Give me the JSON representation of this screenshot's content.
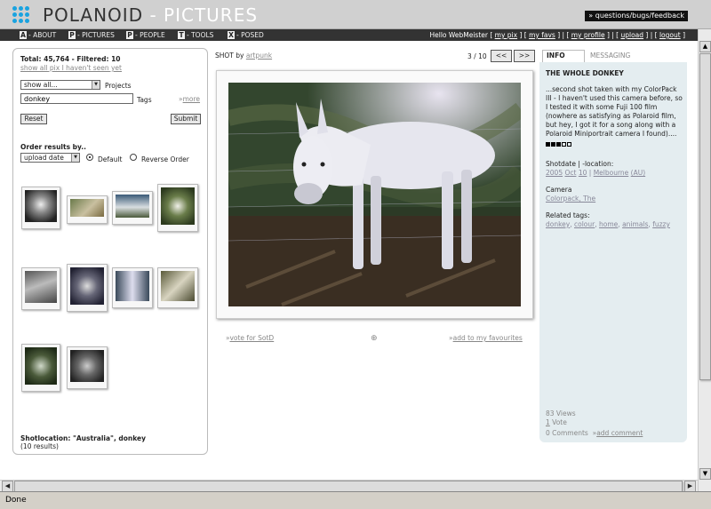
{
  "header": {
    "brand_main": "POLANOID",
    "brand_sub": " - PICTURES",
    "feedback_label": "» questions/bugs/feedback",
    "logo_icon": "dots-grid-icon",
    "logo_color": "#1aa3e0"
  },
  "nav": {
    "items": [
      {
        "key": "A",
        "label": "- ABOUT"
      },
      {
        "key": "P",
        "label": "- PICTURES"
      },
      {
        "key": "P",
        "label": "- PEOPLE"
      },
      {
        "key": "T",
        "label": "- TOOLS"
      },
      {
        "key": "X",
        "label": "- POSED"
      }
    ],
    "greeting": "Hello WebMeister",
    "user_links": [
      "my pix",
      "my favs",
      "my profile",
      "upload",
      "logout"
    ]
  },
  "filter": {
    "totals": "Total: 45,764 - Filtered: 10",
    "show_all_link": "show all pix I haven't seen yet",
    "project_select": "show all...",
    "projects_label": "Projects",
    "tags_value": "donkey",
    "tags_label": "Tags",
    "more_prefix": "»",
    "more_label": "more",
    "reset_label": "Reset",
    "submit_label": "Submit",
    "order_label": "Order results by..",
    "order_select": "upload date",
    "default_label": "Default",
    "reverse_label": "Reverse Order",
    "shotlocation": "Shotlocation: \"Australia\", donkey",
    "result_count": "(10 results)"
  },
  "shot": {
    "by_label": "SHOT by",
    "author": "artpunk",
    "pager": "3 / 10",
    "prev_label": "<<",
    "next_label": ">>",
    "vote_prefix": "»",
    "vote_label": "vote for SotD",
    "fav_prefix": "»",
    "fav_label": "add to my favourites"
  },
  "info": {
    "tab_info": "INFO",
    "tab_messaging": "MESSAGING",
    "title": "THE WHOLE DONKEY",
    "description": "...second shot taken with my ColorPack III - I haven't used this camera before, so I tested it with some Fuji 100 film (nowhere as satisfying as Polaroid film, but hey, I got it for a song along with a Polaroid Miniportrait camera I found)....",
    "rating": 3,
    "rating_max": 5,
    "shotdate_label": "Shotdate | -location:",
    "year": "2005",
    "month": "Oct",
    "day": "10",
    "location": "Melbourne",
    "country": "(AU)",
    "camera_label": "Camera",
    "camera": "Colorpack, The",
    "related_label": "Related tags:",
    "related_tags": [
      "donkey",
      "colour",
      "home",
      "animals",
      "fuzzy"
    ],
    "views": "83 Views",
    "votes_count": "1",
    "votes_label": "Vote",
    "comments": "0 Comments",
    "add_comment_prefix": "»",
    "add_comment_label": "add comment"
  },
  "status": {
    "text": "Done"
  }
}
